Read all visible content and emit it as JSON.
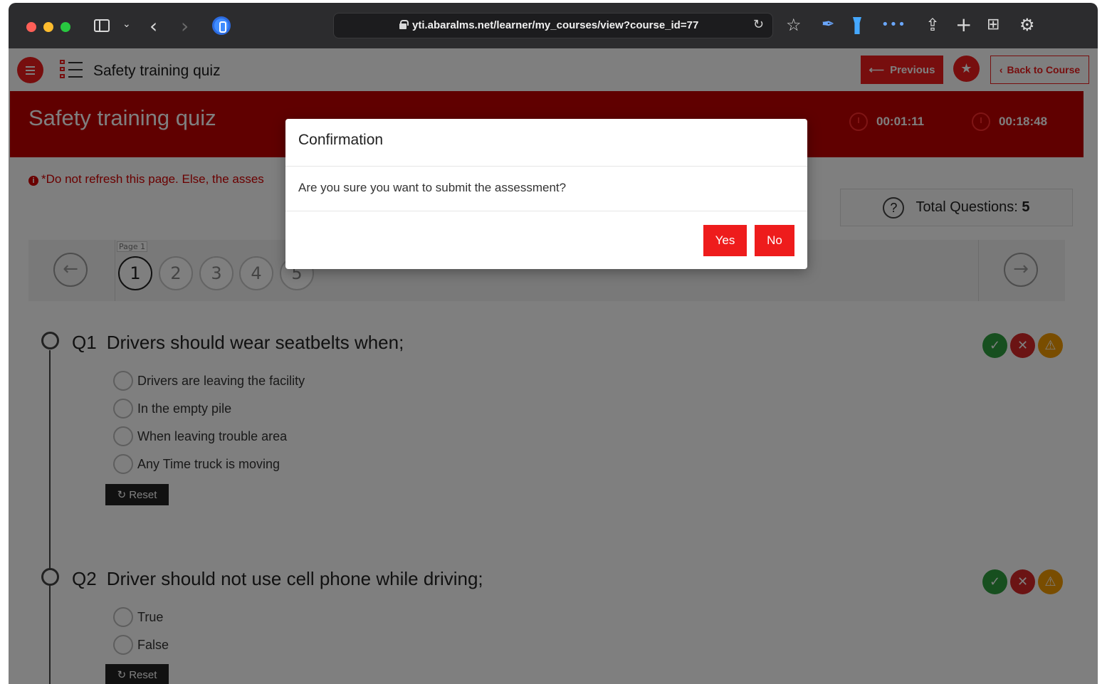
{
  "browser": {
    "url": "yti.abaralms.net/learner/my_courses/view?course_id=77"
  },
  "header": {
    "title": "Safety training quiz",
    "previous_label": "Previous",
    "back_label": "Back to Course"
  },
  "quiz": {
    "banner_title": "Safety training quiz",
    "timer_elapsed": "00:01:11",
    "timer_remaining": "00:18:48",
    "warning_text": "*Do not refresh this page. Else, the asses",
    "total_label": "Total Questions:",
    "total_count": "5",
    "page_label": "Page 1",
    "pages": [
      "1",
      "2",
      "3",
      "4",
      "5"
    ]
  },
  "questions": [
    {
      "number": "Q1",
      "text": "Drivers should wear seatbelts when;",
      "options": [
        "Drivers are leaving the facility",
        "In the empty pile",
        "When leaving trouble area",
        "Any Time truck is moving"
      ],
      "reset_label": "Reset"
    },
    {
      "number": "Q2",
      "text": "Driver should not use cell phone while driving;",
      "options": [
        "True",
        "False"
      ],
      "reset_label": "Reset"
    }
  ],
  "modal": {
    "title": "Confirmation",
    "message": "Are you sure you want to submit the assessment?",
    "yes_label": "Yes",
    "no_label": "No"
  },
  "colors": {
    "brand_red": "#ee1c1c",
    "banner_red": "#c00000",
    "status_ok": "#2e9e3e",
    "status_wrong": "#d62828",
    "status_warn": "#f29b00"
  },
  "icons": {
    "menu": "hamburger-icon",
    "list": "checklist-icon",
    "previous": "arrow-left-icon",
    "favorite": "star-icon",
    "back": "chevron-left-icon",
    "timer": "clock-icon",
    "info": "info-icon",
    "help": "question-circle-icon",
    "status": [
      "check-circle-icon",
      "x-circle-icon",
      "warning-triangle-icon"
    ]
  }
}
